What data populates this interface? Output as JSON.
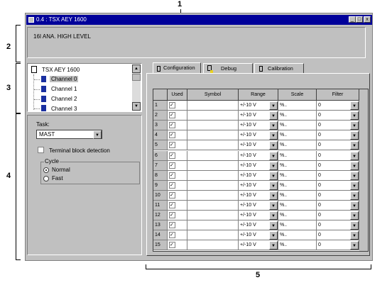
{
  "callouts": [
    "1",
    "2",
    "3",
    "4",
    "5"
  ],
  "window": {
    "title": "0.4 : TSX AEY 1600"
  },
  "module_description": "16I ANA. HIGH LEVEL",
  "tree": {
    "root": "TSX AEY 1600",
    "channels": [
      "Channel 0",
      "Channel 1",
      "Channel 2",
      "Channel 3"
    ],
    "selected_index": 0
  },
  "general": {
    "task_label": "Task:",
    "task_value": "MAST",
    "terminal_block_label": "Terminal block detection",
    "cycle_label": "Cycle",
    "cycle_options": [
      "Normal",
      "Fast"
    ],
    "cycle_selected": "Normal"
  },
  "tabs": [
    {
      "label": "Configuration",
      "active": true
    },
    {
      "label": "Debug",
      "active": false
    },
    {
      "label": "Calibration",
      "active": false
    }
  ],
  "grid": {
    "headers": [
      "Used",
      "Symbol",
      "Range",
      "Scale",
      "Filter"
    ],
    "rows": [
      {
        "num": "1",
        "used": true,
        "symbol": "",
        "range": "+/-10 V",
        "scale": "%..",
        "filter": "0"
      },
      {
        "num": "2",
        "used": true,
        "symbol": "",
        "range": "+/-10 V",
        "scale": "%..",
        "filter": "0"
      },
      {
        "num": "3",
        "used": true,
        "symbol": "",
        "range": "+/-10 V",
        "scale": "%..",
        "filter": "0"
      },
      {
        "num": "4",
        "used": true,
        "symbol": "",
        "range": "+/-10 V",
        "scale": "%..",
        "filter": "0"
      },
      {
        "num": "5",
        "used": true,
        "symbol": "",
        "range": "+/-10 V",
        "scale": "%..",
        "filter": "0"
      },
      {
        "num": "6",
        "used": true,
        "symbol": "",
        "range": "+/-10 V",
        "scale": "%..",
        "filter": "0"
      },
      {
        "num": "7",
        "used": true,
        "symbol": "",
        "range": "+/-10 V",
        "scale": "%..",
        "filter": "0"
      },
      {
        "num": "8",
        "used": true,
        "symbol": "",
        "range": "+/-10 V",
        "scale": "%..",
        "filter": "0"
      },
      {
        "num": "9",
        "used": true,
        "symbol": "",
        "range": "+/-10 V",
        "scale": "%..",
        "filter": "0"
      },
      {
        "num": "10",
        "used": true,
        "symbol": "",
        "range": "+/-10 V",
        "scale": "%..",
        "filter": "0"
      },
      {
        "num": "11",
        "used": true,
        "symbol": "",
        "range": "+/-10 V",
        "scale": "%..",
        "filter": "0"
      },
      {
        "num": "12",
        "used": true,
        "symbol": "",
        "range": "+/-10 V",
        "scale": "%..",
        "filter": "0"
      },
      {
        "num": "13",
        "used": true,
        "symbol": "",
        "range": "+/-10 V",
        "scale": "%..",
        "filter": "0"
      },
      {
        "num": "14",
        "used": true,
        "symbol": "",
        "range": "+/-10 V",
        "scale": "%..",
        "filter": "0"
      },
      {
        "num": "15",
        "used": true,
        "symbol": "",
        "range": "+/-10 V",
        "scale": "%..",
        "filter": "0"
      }
    ]
  },
  "icons": {
    "check": "✓",
    "dropdown": "▼",
    "scroll_up": "▲",
    "scroll_down": "▼"
  }
}
